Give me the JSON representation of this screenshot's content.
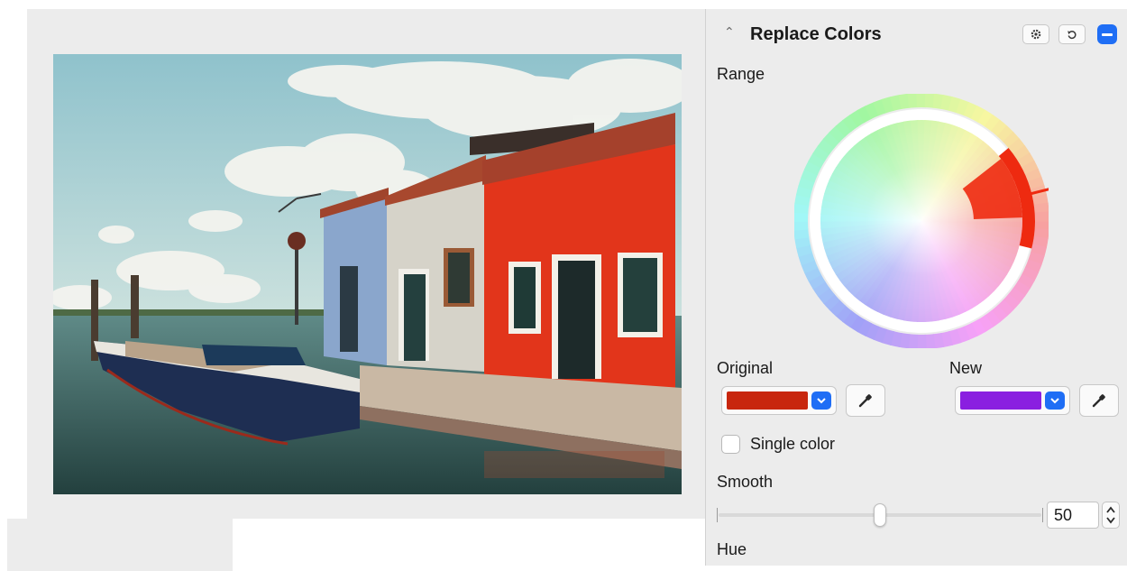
{
  "panel": {
    "title": "Replace Colors",
    "icons": {
      "collapse": "chevron-up-icon",
      "settings": "gear-icon",
      "reset": "reset-icon",
      "remove": "minus-icon"
    },
    "accent_color": "#1f6ef5"
  },
  "range": {
    "label": "Range"
  },
  "original": {
    "label": "Original",
    "color": "#c8260d",
    "icon": "eyedropper-icon"
  },
  "new": {
    "label": "New",
    "color": "#8a1fe0",
    "icon": "eyedropper-icon"
  },
  "single_color": {
    "label": "Single color",
    "checked": false
  },
  "smooth": {
    "label": "Smooth",
    "value": "50",
    "min": 0,
    "max": 100
  },
  "hue": {
    "label": "Hue"
  }
}
